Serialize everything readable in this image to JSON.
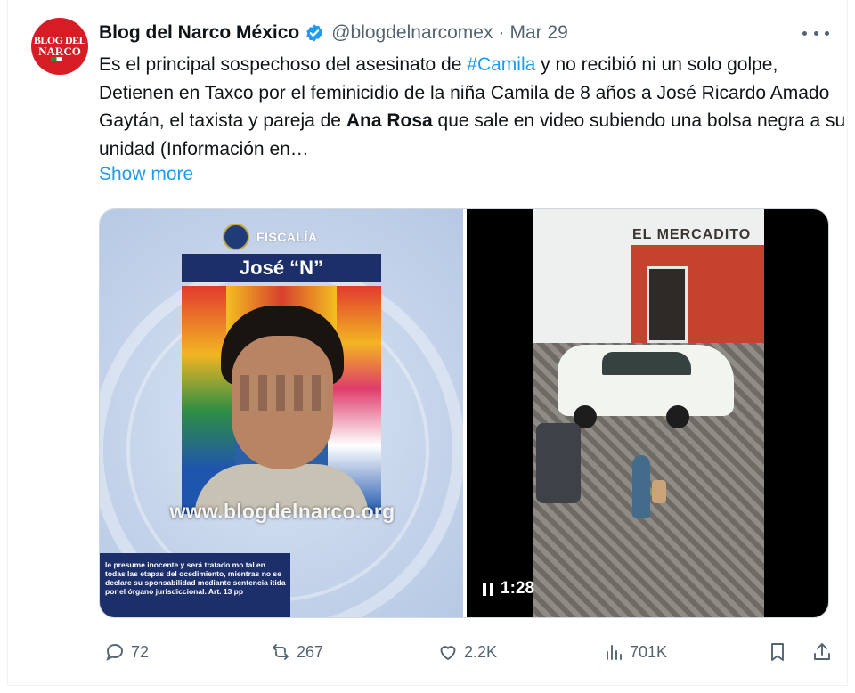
{
  "account": {
    "name": "Blog del Narco México",
    "handle": "@blogdelnarcomex",
    "separator": "·",
    "date": "Mar 29",
    "avatar_text_top": "BLOG DEL",
    "avatar_text_bottom": "NARCO"
  },
  "post": {
    "text_1": "Es el principal sospechoso del asesinato de ",
    "hashtag": "#Camila",
    "text_2": " y no recibió ni un solo golpe, Detienen en Taxco por el feminicidio de la niña Camila de 8 años a José Ricardo Amado Gaytán, el taxista y pareja de ",
    "bold_name": "Ana Rosa",
    "text_3": " que sale en video subiendo una bolsa negra a su unidad (Información en…",
    "show_more": "Show more"
  },
  "media": {
    "left": {
      "fiscalia_label": "FISCALÍA",
      "name_bar": "José “N”",
      "watermark": "www.blogdelnarco.org",
      "legal_text": "le presume inocente y será tratado mo tal en todas las etapas del ocedimiento, mientras no se declare su sponsabilidad mediante sentencia itida por el órgano jurisdiccional. Art. 13 pp"
    },
    "right": {
      "sign_text": "EL MERCADITO",
      "video_time": "1:28"
    }
  },
  "actions": {
    "replies": "72",
    "reposts": "267",
    "likes": "2.2K",
    "views": "701K"
  },
  "colors": {
    "accent": "#1d9bf0",
    "muted": "#536471",
    "text": "#0f1419"
  }
}
